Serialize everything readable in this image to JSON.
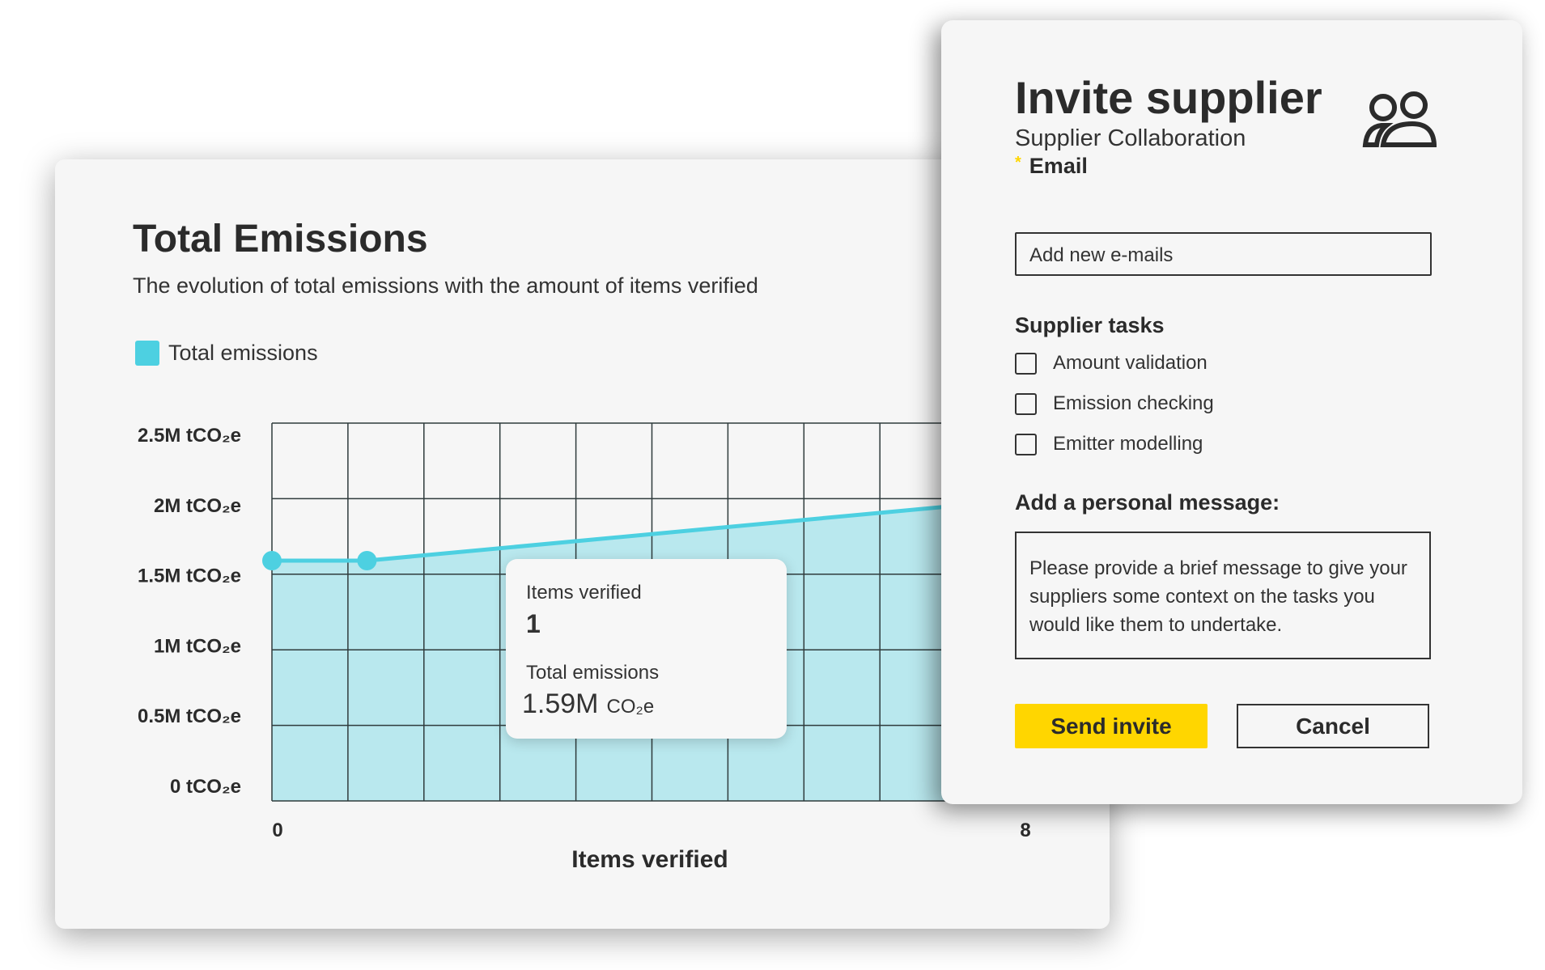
{
  "chart_card": {
    "title": "Total Emissions",
    "subtitle": "The evolution of total emissions with the amount of items verified"
  },
  "colors": {
    "series": "#4dd0e1",
    "fill": "#b9e8ee",
    "grid": "#2f3b3c",
    "accent": "#ffd600"
  },
  "chart_data": {
    "type": "area",
    "xlabel": "Items verified",
    "ylabel": "",
    "xlim": [
      0,
      8
    ],
    "ylim": [
      0,
      2.5
    ],
    "x_ticks": [
      "0",
      "8"
    ],
    "y_ticks": [
      {
        "value": 0,
        "label": "0 tCO₂e"
      },
      {
        "value": 0.5,
        "label": "0.5M tCO₂e"
      },
      {
        "value": 1,
        "label": "1M tCO₂e"
      },
      {
        "value": 1.5,
        "label": "1.5M tCO₂e"
      },
      {
        "value": 2,
        "label": "2M tCO₂e"
      },
      {
        "value": 2.5,
        "label": "2.5M tCO₂e"
      }
    ],
    "grid": true,
    "legend": {
      "placement": "top-left",
      "entries": [
        "Total emissions"
      ]
    },
    "series": [
      {
        "name": "Total emissions",
        "unit": "M tCO₂e",
        "points": [
          [
            0,
            1.59
          ],
          [
            1,
            1.59
          ],
          [
            8,
            2.0
          ]
        ],
        "markers": [
          0,
          1
        ]
      }
    ]
  },
  "tooltip": {
    "label1": "Items verified",
    "value1": "1",
    "label2": "Total emissions",
    "value2": "1.59M",
    "unit2": "CO₂e"
  },
  "dialog": {
    "title": "Invite supplier",
    "subtitle": "Supplier Collaboration",
    "icon": "users-icon",
    "email_label": "Email",
    "required_mark": "*",
    "email_placeholder": "Add new e-mails",
    "tasks_label": "Supplier tasks",
    "tasks": [
      {
        "label": "Amount validation",
        "checked": false
      },
      {
        "label": "Emission checking",
        "checked": false
      },
      {
        "label": "Emitter modelling",
        "checked": false
      }
    ],
    "message_label": "Add a personal message:",
    "message_placeholder": "Please provide a brief message to give your suppliers some context on the tasks you would like them to undertake.",
    "send_label": "Send invite",
    "cancel_label": "Cancel"
  }
}
